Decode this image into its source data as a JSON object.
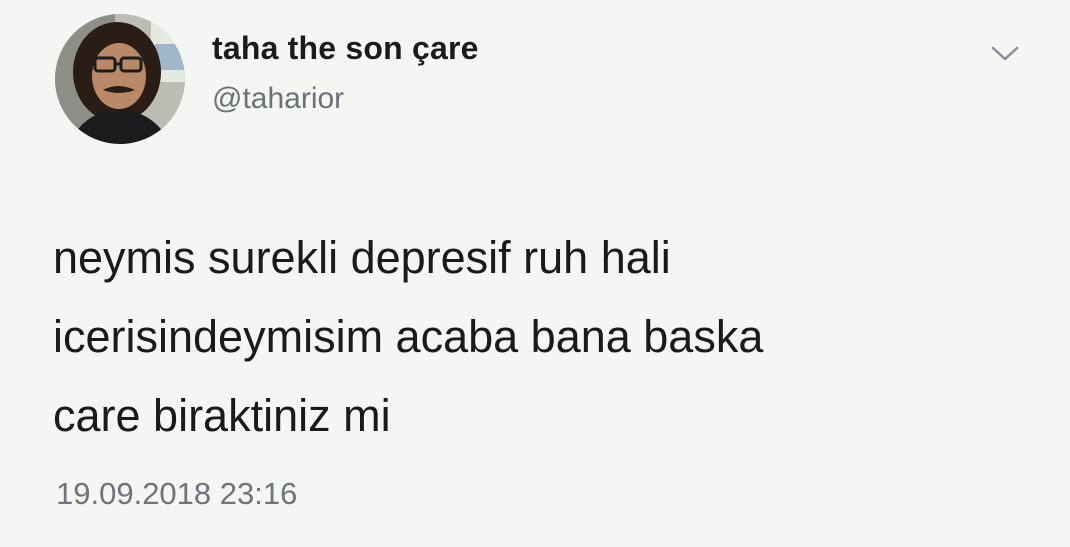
{
  "author": {
    "display_name": "taha the son çare",
    "handle": "@taharior",
    "avatar_icon": "user-avatar-photo"
  },
  "menu": {
    "icon": "chevron-down-icon"
  },
  "tweet": {
    "lines": [
      "neymis surekli depresif ruh hali",
      "icerisindeymisim acaba bana baska",
      "care biraktiniz mi"
    ],
    "timestamp": "19.09.2018 23:16"
  },
  "colors": {
    "background": "#f3f6f2",
    "text": "#1a1a1a",
    "secondary": "#6c7177"
  }
}
